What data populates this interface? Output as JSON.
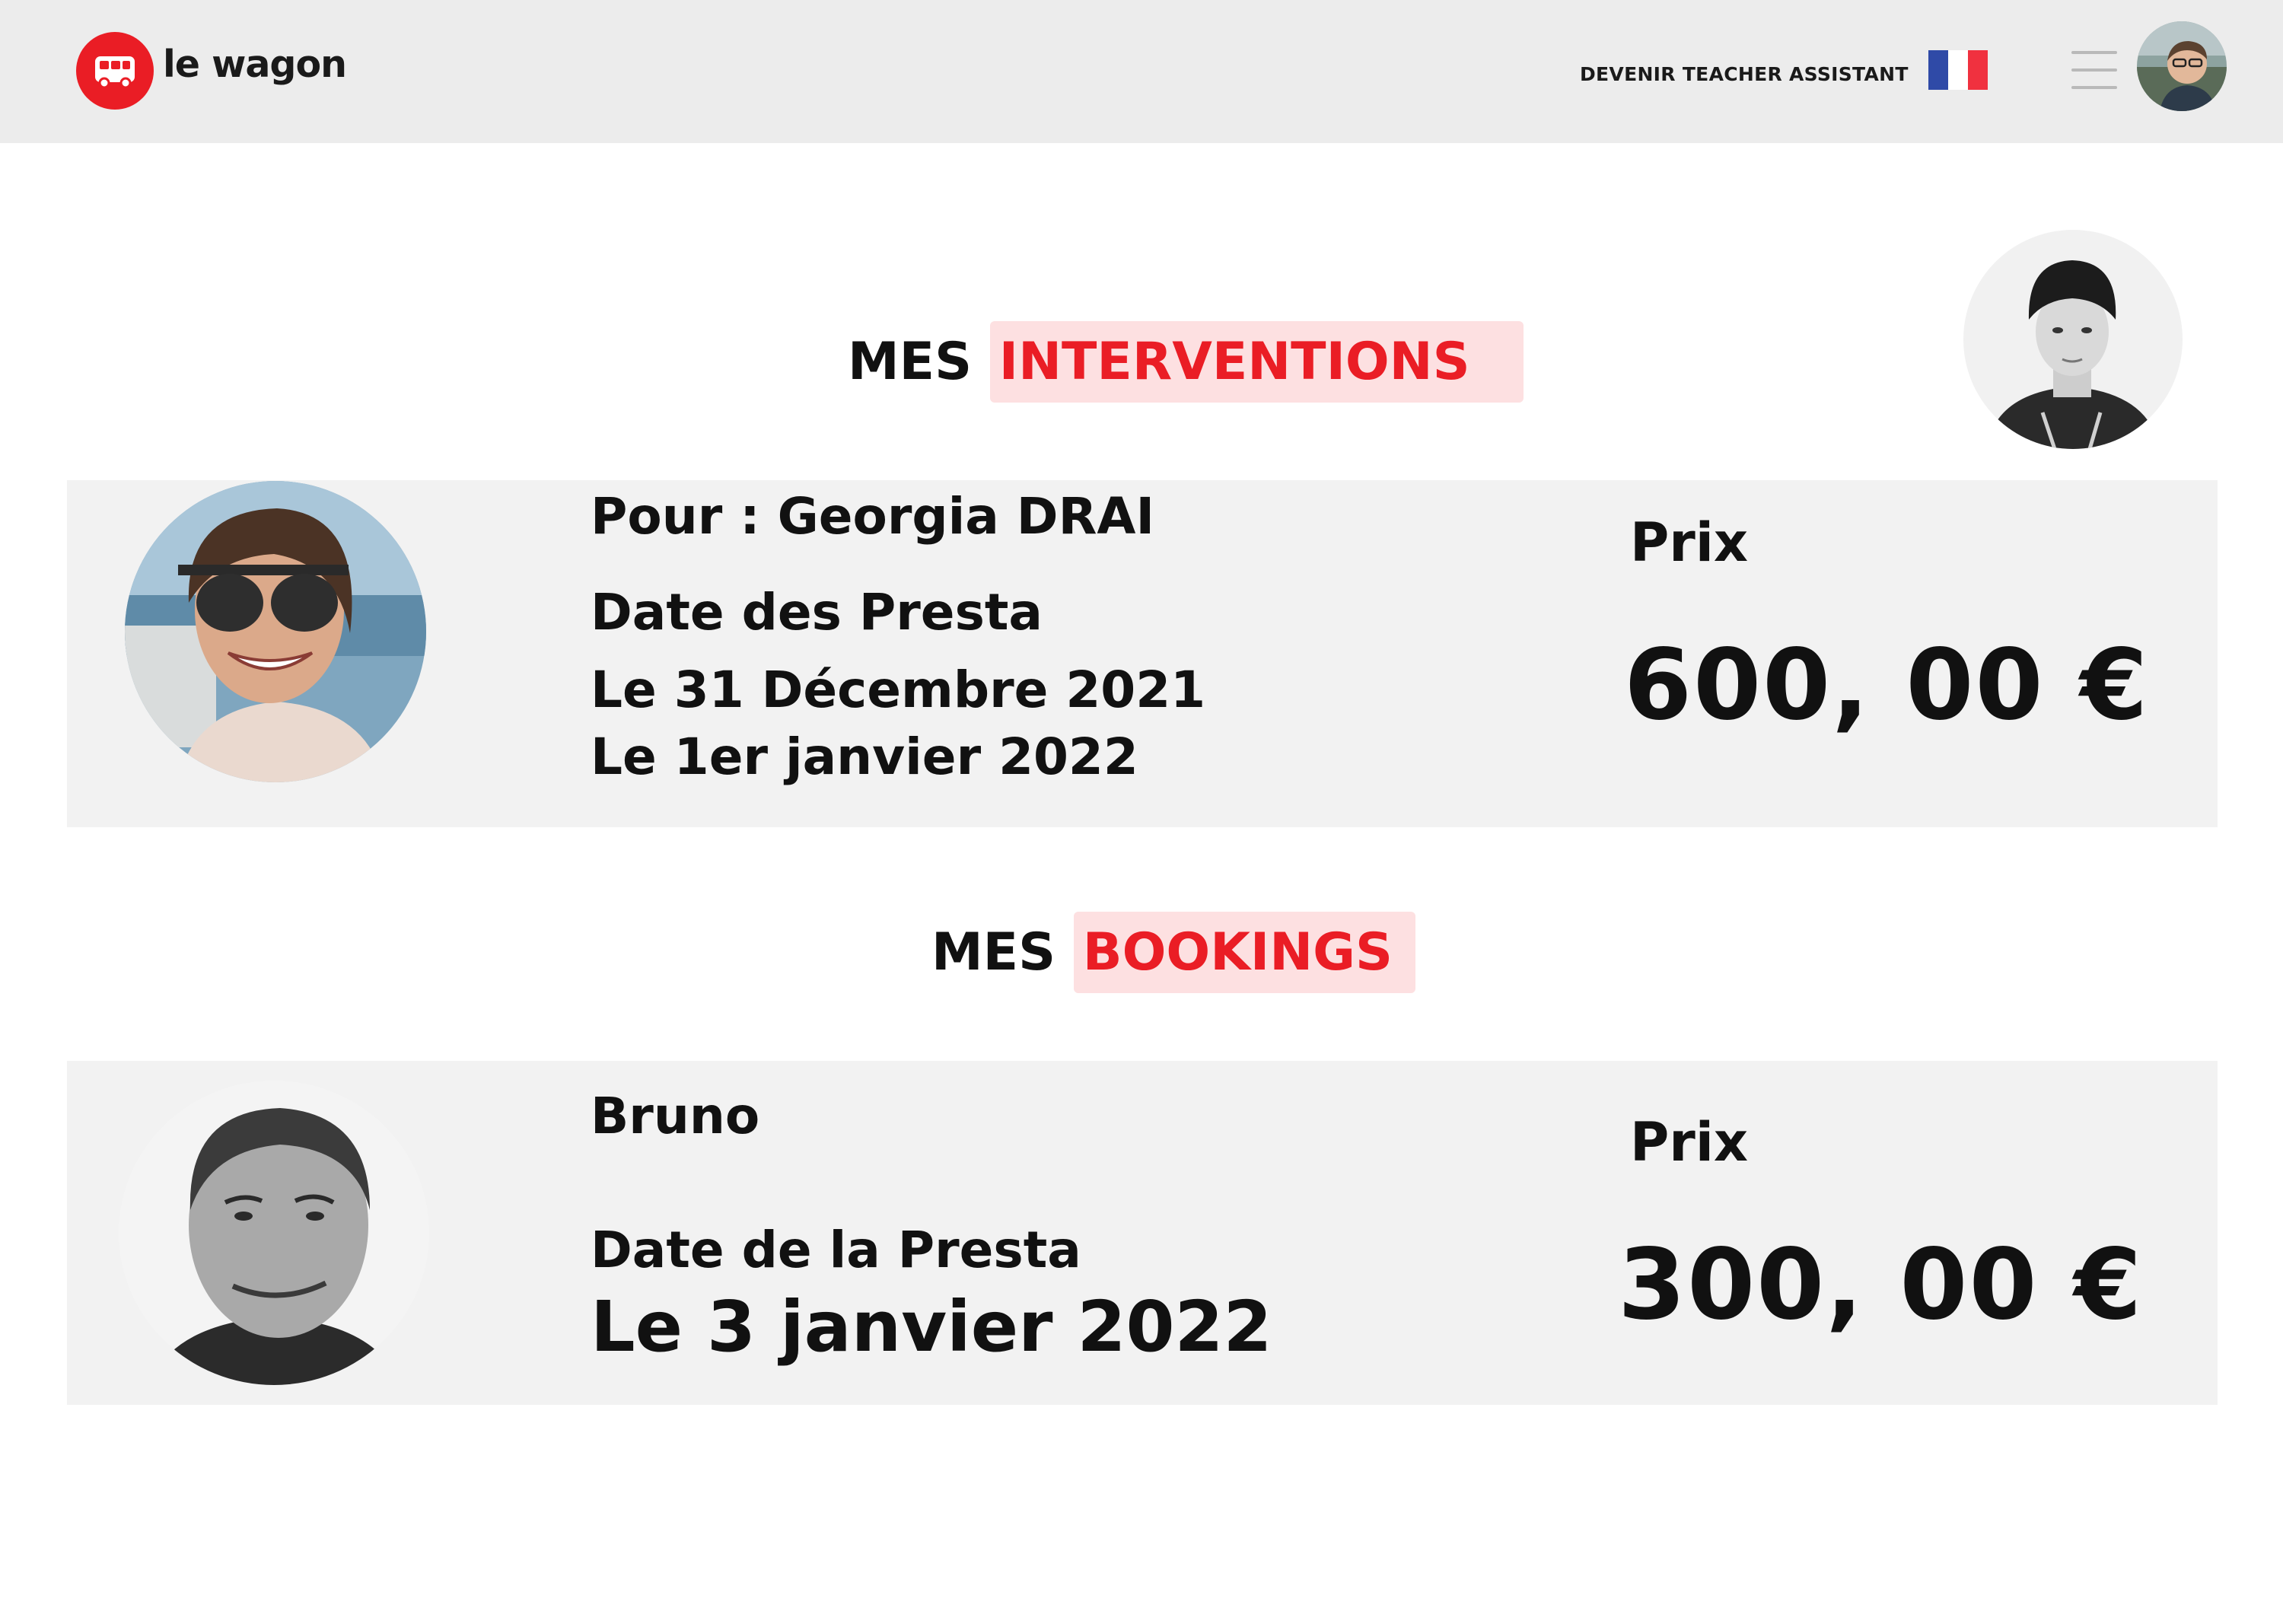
{
  "brand": {
    "name": "le wagon",
    "accent": "#ea1d25",
    "logo_icon": "bus-icon"
  },
  "nav": {
    "cta_label": "DEVENIR TEACHER ASSISTANT",
    "language_icon": "french-flag-icon",
    "menu_icon": "hamburger-menu-icon"
  },
  "interventions": {
    "title_prefix": "MES",
    "title_highlight": "INTERVENTIONS",
    "card": {
      "for_line": "Pour : Georgia DRAI",
      "dates_label": "Date des Presta",
      "dates": [
        "Le 31 Décembre 2021",
        "Le 1er janvier 2022"
      ],
      "price_label": "Prix",
      "price": "600, 00 €"
    }
  },
  "bookings": {
    "title_prefix": "MES",
    "title_highlight": "BOOKINGS",
    "card": {
      "name": "Bruno",
      "date_label": "Date de la Presta",
      "date": "Le 3 janvier 2022",
      "price_label": "Prix",
      "price": "300, 00 €"
    }
  },
  "colors": {
    "navbar_bg": "#ececec",
    "card_bg": "#f2f2f2",
    "highlight_bg": "#fde0e1",
    "accent": "#ea1d25"
  }
}
